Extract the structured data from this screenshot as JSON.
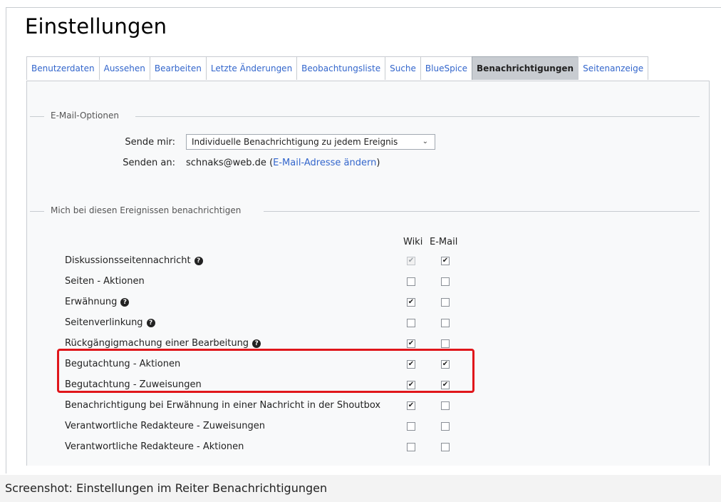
{
  "page": {
    "title": "Einstellungen"
  },
  "tabs": [
    {
      "label": "Benutzerdaten",
      "active": false
    },
    {
      "label": "Aussehen",
      "active": false
    },
    {
      "label": "Bearbeiten",
      "active": false
    },
    {
      "label": "Letzte Änderungen",
      "active": false
    },
    {
      "label": "Beobachtungsliste",
      "active": false
    },
    {
      "label": "Suche",
      "active": false
    },
    {
      "label": "BlueSpice",
      "active": false
    },
    {
      "label": "Benachrichtigungen",
      "active": true
    },
    {
      "label": "Seitenanzeige",
      "active": false
    }
  ],
  "email_options": {
    "legend": "E-Mail-Optionen",
    "send_me_label": "Sende mir:",
    "send_me_value": "Individuelle Benachrichtigung zu jedem Ereignis",
    "send_to_label": "Senden an:",
    "send_to_address": "schnaks@web.de",
    "change_link": "E-Mail-Adresse ändern"
  },
  "events": {
    "legend": "Mich bei diesen Ereignissen benachrichtigen",
    "col_wiki": "Wiki",
    "col_email": "E-Mail",
    "rows": [
      {
        "label": "Diskussionsseitennachricht",
        "help": true,
        "wiki": true,
        "wiki_disabled": true,
        "email": true
      },
      {
        "label": "Seiten - Aktionen",
        "help": false,
        "wiki": false,
        "wiki_disabled": false,
        "email": false
      },
      {
        "label": "Erwähnung",
        "help": true,
        "wiki": true,
        "wiki_disabled": false,
        "email": false
      },
      {
        "label": "Seitenverlinkung",
        "help": true,
        "wiki": false,
        "wiki_disabled": false,
        "email": false
      },
      {
        "label": "Rückgängigmachung einer Bearbeitung",
        "help": true,
        "wiki": true,
        "wiki_disabled": false,
        "email": false
      },
      {
        "label": "Begutachtung - Aktionen",
        "help": false,
        "wiki": true,
        "wiki_disabled": false,
        "email": true
      },
      {
        "label": "Begutachtung - Zuweisungen",
        "help": false,
        "wiki": true,
        "wiki_disabled": false,
        "email": true
      },
      {
        "label": "Benachrichtigung bei Erwähnung in einer Nachricht in der Shoutbox",
        "help": false,
        "wiki": true,
        "wiki_disabled": false,
        "email": false
      },
      {
        "label": "Verantwortliche Redakteure - Zuweisungen",
        "help": false,
        "wiki": false,
        "wiki_disabled": false,
        "email": false
      },
      {
        "label": "Verantwortliche Redakteure - Aktionen",
        "help": false,
        "wiki": false,
        "wiki_disabled": false,
        "email": false
      }
    ]
  },
  "caption": "Screenshot: Einstellungen im Reiter Benachrichtigungen",
  "colors": {
    "link": "#3366cc",
    "highlight": "#e0161b",
    "active_tab": "#c8ccd1"
  },
  "icons": {
    "help": "question-circle-icon",
    "check": "checkmark-icon",
    "dropdown": "chevron-down-icon"
  }
}
